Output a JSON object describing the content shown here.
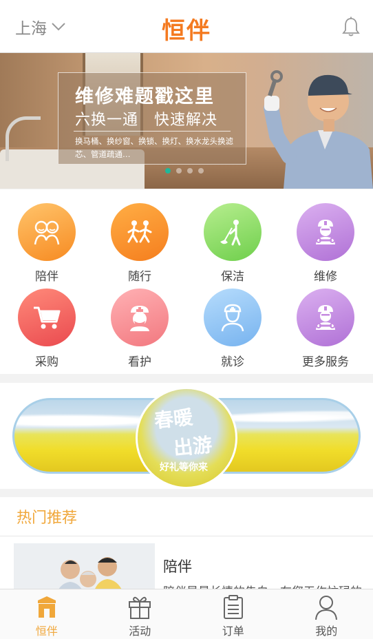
{
  "header": {
    "city": "上海",
    "logo": "恒伴"
  },
  "banner": {
    "headline": "维修难题戳这里",
    "subhead": "六换一通　快速解决",
    "details": "换马桶、换纱窗、换锁、换灯、换水龙头换滤芯、管道疏通…",
    "slide_count": 4,
    "active_slide": 1
  },
  "services": [
    {
      "label": "陪伴",
      "icon": "companion-icon",
      "color": "#f9a03c"
    },
    {
      "label": "随行",
      "icon": "walking-icon",
      "color": "#f7942b"
    },
    {
      "label": "保洁",
      "icon": "cleaning-icon",
      "color": "#8fdc6a"
    },
    {
      "label": "维修",
      "icon": "repairman-icon",
      "color": "#c58ae0"
    },
    {
      "label": "采购",
      "icon": "cart-icon",
      "color": "#f05a5a"
    },
    {
      "label": "看护",
      "icon": "nurse-icon",
      "color": "#f78f95"
    },
    {
      "label": "就诊",
      "icon": "doctor-icon",
      "color": "#8ec4f5"
    },
    {
      "label": "更多服务",
      "icon": "more-service-icon",
      "color": "#c58ae0"
    }
  ],
  "promo": {
    "line1": "春暖",
    "line2": "出游",
    "line3": "好礼等你来"
  },
  "hot": {
    "title": "热门推荐"
  },
  "recommendation": {
    "name": "陪伴",
    "desc": "陪伴是最长情的告白，在您无作忙碌的"
  },
  "tabs": [
    {
      "label": "恒伴",
      "icon": "home-icon",
      "active": true
    },
    {
      "label": "活动",
      "icon": "gift-icon",
      "active": false
    },
    {
      "label": "订单",
      "icon": "order-icon",
      "active": false
    },
    {
      "label": "我的",
      "icon": "user-icon",
      "active": false
    }
  ],
  "colors": {
    "brand": "#f47a20",
    "accent": "#f0a73a",
    "dot_active": "#1fb89a"
  }
}
